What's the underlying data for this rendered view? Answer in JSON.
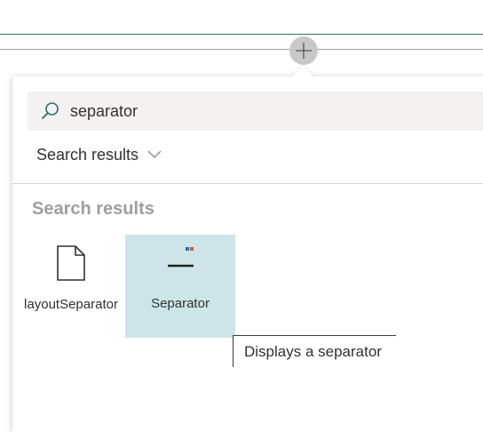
{
  "search": {
    "value": "separator",
    "icon": "search-icon"
  },
  "filter": {
    "selected": "Search results",
    "icon": "chevron-down-icon"
  },
  "results": {
    "title": "Search results",
    "items": [
      {
        "label": "layoutSeparator",
        "icon": "document-icon"
      },
      {
        "label": "Separator",
        "icon": "separator-icon"
      }
    ]
  },
  "tooltip": {
    "text": "Displays a separator"
  },
  "colors": {
    "accent": "#2f6f6a",
    "selected_tile": "#cde5e9",
    "search_bg": "#f3f2f1"
  }
}
